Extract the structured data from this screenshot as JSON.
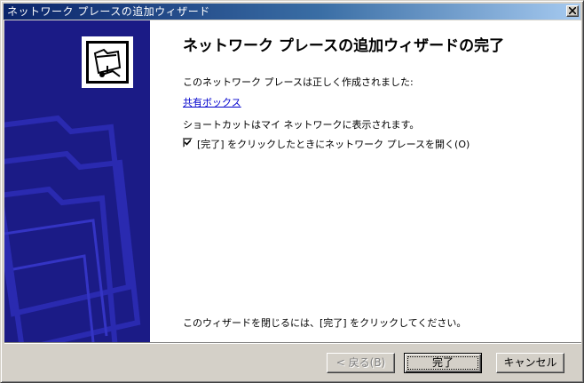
{
  "window": {
    "title": "ネットワーク プレースの追加ウィザード"
  },
  "content": {
    "heading": "ネットワーク プレースの追加ウィザードの完了",
    "created_text": "このネットワーク プレースは正しく作成されました:",
    "place_name": "共有ボックス",
    "shortcut_text": "ショートカットはマイ ネットワークに表示されます。",
    "checkbox_label": "[完了] をクリックしたときにネットワーク プレースを開く(O)",
    "checkbox_checked": true,
    "footer_text": "このウィザードを閉じるには、[完了] をクリックしてください。"
  },
  "buttons": {
    "back_label": "< 戻る(B)",
    "finish_label": "完了",
    "cancel_label": "キャンセル"
  },
  "icons": {
    "close": "close-icon",
    "wizard": "network-folder-icon",
    "check": "checkmark-icon"
  },
  "colors": {
    "sidebar": "#1b1b86",
    "title_start": "#0a246a",
    "title_end": "#a6caf0",
    "link": "#0000cc"
  }
}
